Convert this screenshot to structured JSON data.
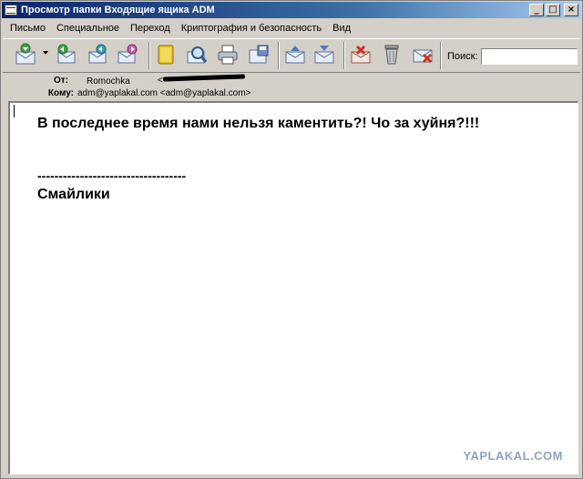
{
  "window": {
    "title": "Просмотр папки Входящие ящика ADM",
    "controls": {
      "minimize": "_",
      "maximize": "□",
      "close": "×"
    }
  },
  "menu": [
    {
      "label": "Письмо"
    },
    {
      "label": "Специальное"
    },
    {
      "label": "Переход"
    },
    {
      "label": "Криптография и безопасность"
    },
    {
      "label": "Вид"
    }
  ],
  "toolbar": {
    "buttons": [
      {
        "icon": "get-mail-icon"
      },
      {
        "icon": "reply-icon"
      },
      {
        "icon": "reply-all-icon"
      },
      {
        "icon": "forward-icon"
      },
      {
        "icon": "address-book-icon"
      },
      {
        "icon": "find-icon"
      },
      {
        "icon": "print-icon"
      },
      {
        "icon": "save-icon"
      },
      {
        "icon": "previous-message-icon"
      },
      {
        "icon": "next-message-icon"
      },
      {
        "icon": "mark-spam-icon"
      },
      {
        "icon": "delete-icon"
      },
      {
        "icon": "delete-message-icon"
      }
    ],
    "search_label": "Поиск:",
    "search_value": ""
  },
  "header": {
    "from_label": "От:",
    "from_name": "Romochka",
    "from_email_prefix": "<",
    "to_label": "Кому:",
    "to_value": "adm@yaplakal.com <adm@yaplakal.com>"
  },
  "body": {
    "line1": "В последнее время нами нельзя каментить?! Чо за хуйня?!!!",
    "separator": "-----------------------------------",
    "line3": "Смайлики",
    "watermark": "YAPLAKAL.COM"
  },
  "colors": {
    "title_bar_start": "#0a246a",
    "title_bar_end": "#a6caf0",
    "chrome": "#d4d0c8",
    "watermark": "#8aa3c9"
  }
}
